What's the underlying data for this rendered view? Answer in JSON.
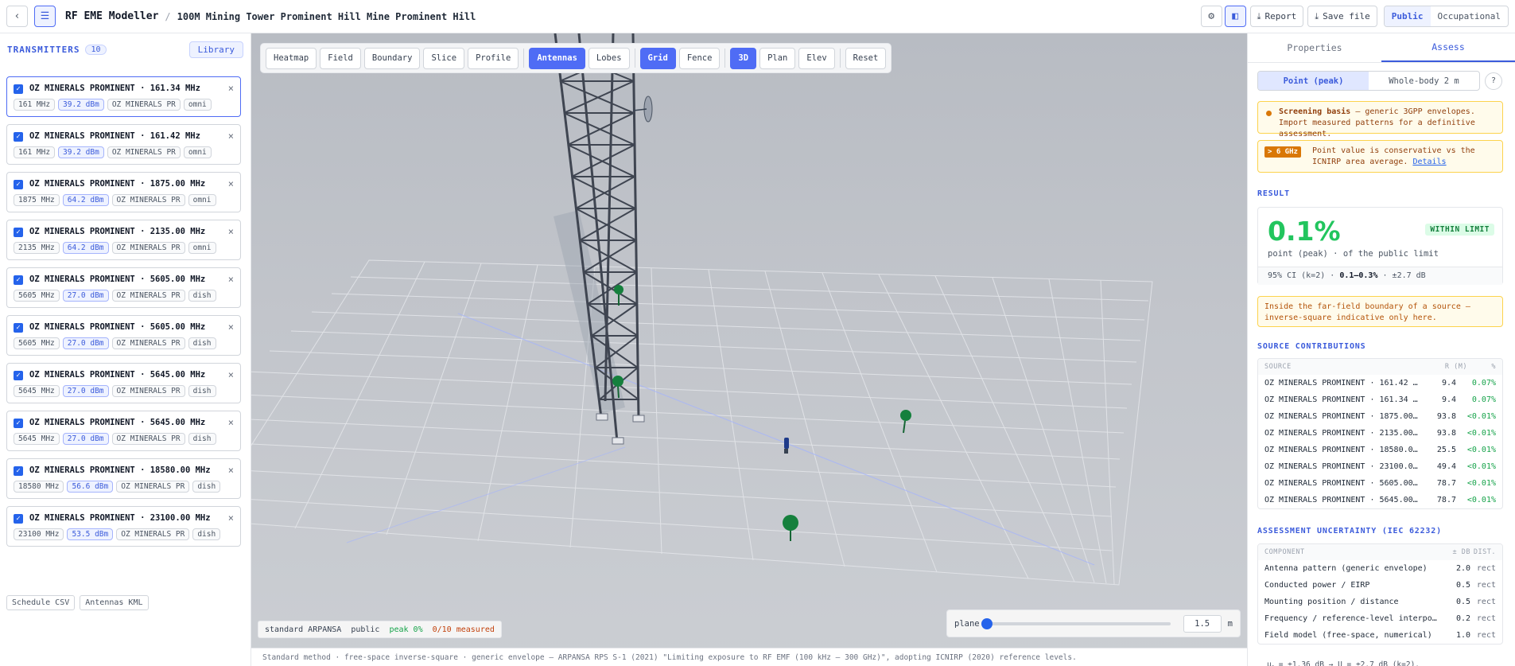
{
  "header": {
    "app_title": "RF EME Modeller",
    "separator": "/",
    "project": "100M Mining Tower Prominent Hill Mine Prominent Hill",
    "report_label": "Report",
    "save_label": "Save file",
    "modes": [
      "Public",
      "Occupational"
    ],
    "active_mode": "Public"
  },
  "transmitters": {
    "title": "TRANSMITTERS",
    "count": "10",
    "library_label": "Library",
    "items": [
      {
        "name": "OZ MINERALS PROMINENT · 161.34 MHz",
        "freq": "161 MHz",
        "power": "39.2 dBm",
        "site": "OZ MINERALS PR",
        "type": "omni",
        "checked": true
      },
      {
        "name": "OZ MINERALS PROMINENT · 161.42 MHz",
        "freq": "161 MHz",
        "power": "39.2 dBm",
        "site": "OZ MINERALS PR",
        "type": "omni",
        "checked": true
      },
      {
        "name": "OZ MINERALS PROMINENT · 1875.00 MHz",
        "freq": "1875 MHz",
        "power": "64.2 dBm",
        "site": "OZ MINERALS PR",
        "type": "omni",
        "checked": true
      },
      {
        "name": "OZ MINERALS PROMINENT · 2135.00 MHz",
        "freq": "2135 MHz",
        "power": "64.2 dBm",
        "site": "OZ MINERALS PR",
        "type": "omni",
        "checked": true
      },
      {
        "name": "OZ MINERALS PROMINENT · 5605.00 MHz",
        "freq": "5605 MHz",
        "power": "27.0 dBm",
        "site": "OZ MINERALS PR",
        "type": "dish",
        "checked": true
      },
      {
        "name": "OZ MINERALS PROMINENT · 5605.00 MHz",
        "freq": "5605 MHz",
        "power": "27.0 dBm",
        "site": "OZ MINERALS PR",
        "type": "dish",
        "checked": true
      },
      {
        "name": "OZ MINERALS PROMINENT · 5645.00 MHz",
        "freq": "5645 MHz",
        "power": "27.0 dBm",
        "site": "OZ MINERALS PR",
        "type": "dish",
        "checked": true
      },
      {
        "name": "OZ MINERALS PROMINENT · 5645.00 MHz",
        "freq": "5645 MHz",
        "power": "27.0 dBm",
        "site": "OZ MINERALS PR",
        "type": "dish",
        "checked": true
      },
      {
        "name": "OZ MINERALS PROMINENT · 18580.00 MHz",
        "freq": "18580 MHz",
        "power": "56.6 dBm",
        "site": "OZ MINERALS PR",
        "type": "dish",
        "checked": true
      },
      {
        "name": "OZ MINERALS PROMINENT · 23100.00 MHz",
        "freq": "23100 MHz",
        "power": "53.5 dBm",
        "site": "OZ MINERALS PR",
        "type": "dish",
        "checked": true
      }
    ],
    "footer_buttons": [
      "Schedule CSV",
      "Antennas KML"
    ]
  },
  "toolbar": {
    "layers": [
      "Heatmap",
      "Field",
      "Boundary",
      "Slice",
      "Profile"
    ],
    "overlays": [
      "Antennas",
      "Lobes"
    ],
    "helpers": [
      "Grid",
      "Fence"
    ],
    "views": [
      "3D",
      "Plan",
      "Elev"
    ],
    "reset": "Reset",
    "active": [
      "Antennas",
      "Grid",
      "3D"
    ]
  },
  "viewport_status": {
    "standard": "standard ARPANSA",
    "mode": "public",
    "peak": "peak 0%",
    "measured": "0/10 measured"
  },
  "plane": {
    "label": "plane",
    "value": "1.5",
    "unit": "m",
    "slider_fraction": 0.0
  },
  "footnote": "Standard method · free-space inverse-square · generic envelope — ARPANSA RPS S-1 (2021) \"Limiting exposure to RF EMF (100 kHz – 300 GHz)\", adopting ICNIRP (2020) reference levels.",
  "panel": {
    "tabs": [
      "Properties",
      "Assess"
    ],
    "active_tab": "Assess",
    "assess_modes": [
      "Point (peak)",
      "Whole-body 2 m"
    ],
    "help": "?",
    "screening_title": "Screening basis",
    "screening_text": " — generic 3GPP envelopes. Import measured patterns for a definitive assessment.",
    "ghz_tag": "> 6 GHz",
    "ghz_text": "Point value is conservative vs the ICNIRP area average. ",
    "ghz_link": "Details",
    "result_title": "RESULT",
    "result_value": "0.1%",
    "result_badge": "WITHIN LIMIT",
    "result_sub": "point (peak) · of the public limit",
    "ci_label": "95% CI (k=2) · ",
    "ci_range": "0.1–0.3%",
    "ci_db": " · ±2.7 dB",
    "farfield_note": "Inside the far-field boundary of a source — inverse-square indicative only here.",
    "contrib_title": "SOURCE CONTRIBUTIONS",
    "contrib_headers": [
      "SOURCE",
      "R (M)",
      "%"
    ],
    "contributions": [
      {
        "source": "OZ MINERALS PROMINENT · 161.42 MHz",
        "r": "9.4",
        "pct": "0.07%"
      },
      {
        "source": "OZ MINERALS PROMINENT · 161.34 MHz",
        "r": "9.4",
        "pct": "0.07%"
      },
      {
        "source": "OZ MINERALS PROMINENT · 1875.00 MHz",
        "r": "93.8",
        "pct": "<0.01%"
      },
      {
        "source": "OZ MINERALS PROMINENT · 2135.00 MHz",
        "r": "93.8",
        "pct": "<0.01%"
      },
      {
        "source": "OZ MINERALS PROMINENT · 18580.00 M…",
        "r": "25.5",
        "pct": "<0.01%"
      },
      {
        "source": "OZ MINERALS PROMINENT · 23100.00 M…",
        "r": "49.4",
        "pct": "<0.01%"
      },
      {
        "source": "OZ MINERALS PROMINENT · 5605.00 MHz",
        "r": "78.7",
        "pct": "<0.01%"
      },
      {
        "source": "OZ MINERALS PROMINENT · 5645.00 MHz",
        "r": "78.7",
        "pct": "<0.01%"
      }
    ],
    "unc_title": "ASSESSMENT UNCERTAINTY (IEC 62232)",
    "unc_headers": [
      "COMPONENT",
      "± DB",
      "DIST."
    ],
    "uncertainty": [
      {
        "component": "Antenna pattern (generic envelope)",
        "db": "2.0",
        "dist": "rect"
      },
      {
        "component": "Conducted power / EIRP",
        "db": "0.5",
        "dist": "rect"
      },
      {
        "component": "Mounting position / distance",
        "db": "0.5",
        "dist": "rect"
      },
      {
        "component": "Frequency / reference-level interpol…",
        "db": "0.2",
        "dist": "rect"
      },
      {
        "component": "Field model (free-space, numerical)",
        "db": "1.0",
        "dist": "rect"
      }
    ],
    "combined": "u꜀ = ±1.36 dB → U = ±2.7 dB (k=2)."
  },
  "colors": {
    "accent": "#4f6cf5",
    "ok": "#22c55e",
    "warn": "#d97706"
  }
}
